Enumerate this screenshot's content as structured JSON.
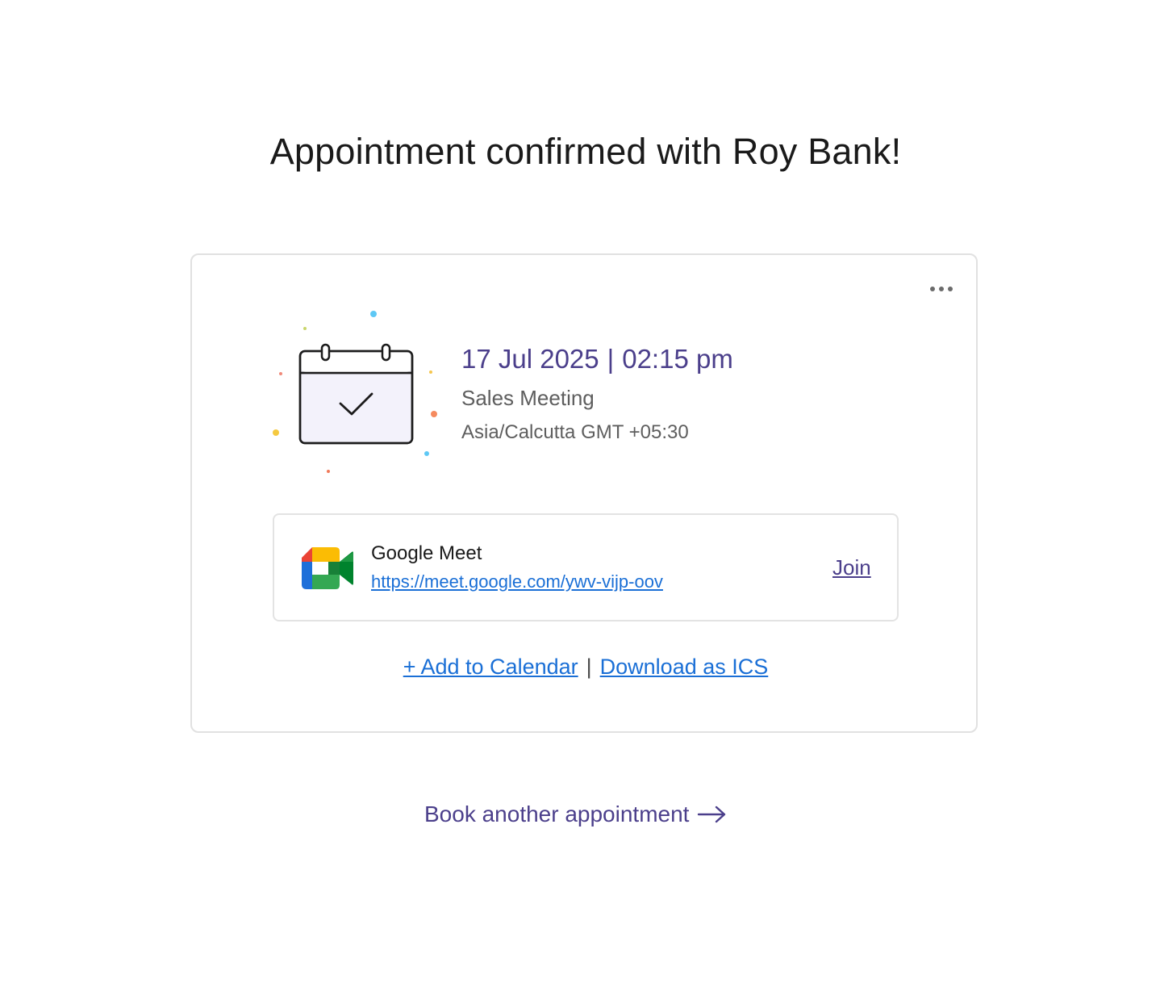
{
  "page": {
    "title": "Appointment confirmed with Roy Bank!"
  },
  "card": {
    "more_icon": "more-horizontal-icon",
    "illustration_icon": "calendar-check-icon",
    "date": "17 Jul 2025",
    "separator": "|",
    "time": "02:15 pm",
    "meeting_name": "Sales Meeting",
    "timezone": "Asia/Calcutta GMT +05:30",
    "accent_color": "#4b3f8b"
  },
  "meeting": {
    "provider_icon": "google-meet-icon",
    "provider": "Google Meet",
    "url": "https://meet.google.com/ywv-vijp-oov",
    "join_label": "Join"
  },
  "calendar_actions": {
    "add_label": "+ Add to Calendar",
    "divider": "|",
    "download_label": "Download as ICS",
    "link_color": "#1a6fd6"
  },
  "footer": {
    "book_another_label": "Book another appointment",
    "arrow_icon": "arrow-right-icon"
  }
}
